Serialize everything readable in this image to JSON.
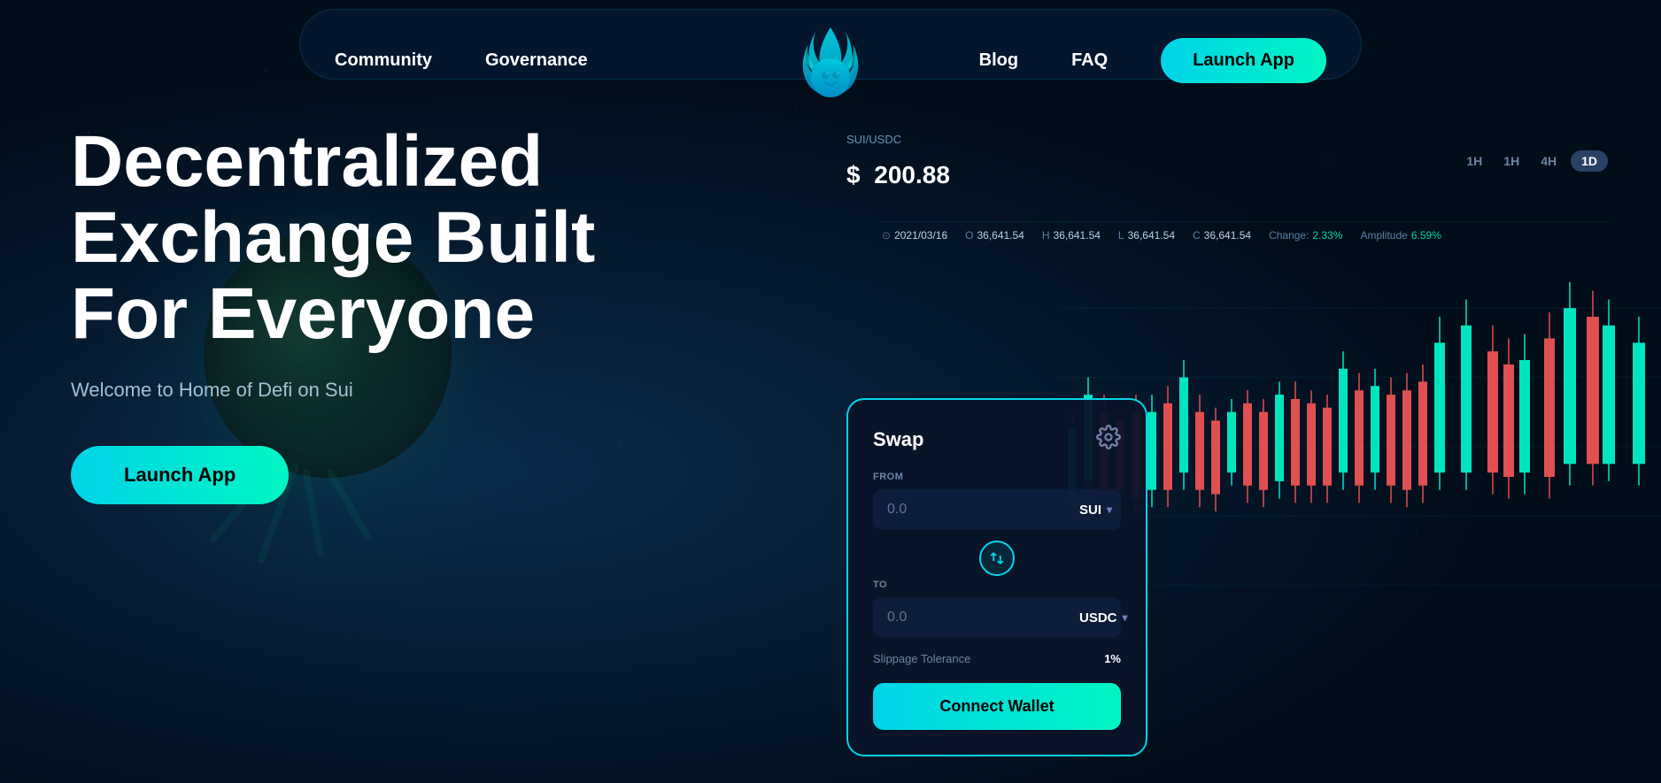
{
  "nav": {
    "links": [
      {
        "id": "community",
        "label": "Community"
      },
      {
        "id": "governance",
        "label": "Governance"
      },
      {
        "id": "blog",
        "label": "Blog"
      },
      {
        "id": "faq",
        "label": "FAQ"
      }
    ],
    "launch_btn_label": "Launch App"
  },
  "hero": {
    "title": "Decentralized Exchange Built For Everyone",
    "subtitle": "Welcome to Home of Defi on Sui",
    "launch_btn_label": "Launch App"
  },
  "chart": {
    "pair": "SUI/USDC",
    "price_symbol": "$",
    "price": "200.88",
    "time_filters": [
      "1H",
      "1H",
      "4H",
      "1D"
    ],
    "active_filter": "1D",
    "stats": {
      "date": "2021/03/16",
      "o_label": "O",
      "o_value": "36,641.54",
      "h_label": "H",
      "h_value": "36,641.54",
      "l_label": "L",
      "l_value": "36,641.54",
      "c_label": "C",
      "c_value": "36,641.54",
      "change_label": "Change:",
      "change_value": "2.33%",
      "amplitude_label": "Amplitude",
      "amplitude_value": "6.59%"
    }
  },
  "swap": {
    "title": "Swap",
    "from_label": "FROM",
    "from_value": "0.0",
    "from_token": "SUI",
    "to_label": "TO",
    "to_value": "0.0",
    "to_token": "USDC",
    "slippage_label": "Slippage Tolerance",
    "slippage_value": "1%",
    "connect_wallet_label": "Connect Wallet"
  },
  "colors": {
    "accent_cyan": "#00d4e8",
    "accent_green": "#00f5c4",
    "bg_dark": "#020d1a",
    "candle_green": "#00e5c0",
    "candle_red": "#e05050"
  }
}
